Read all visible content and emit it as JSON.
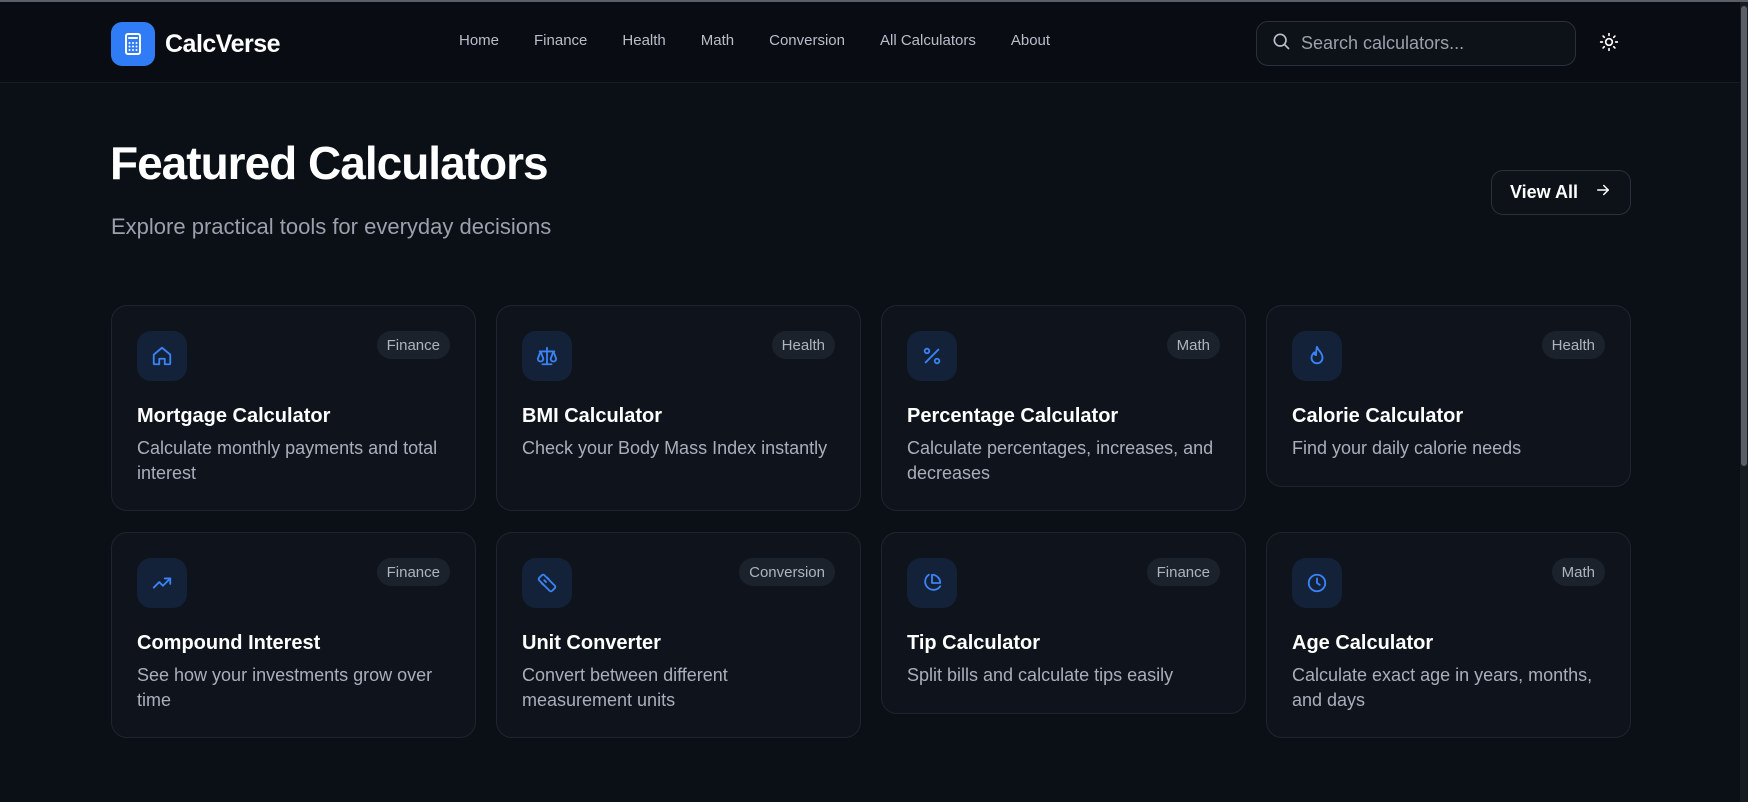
{
  "brand": {
    "name": "CalcVerse",
    "icon": "calculator-icon",
    "accent": "#2f7cf6"
  },
  "nav": {
    "items": [
      {
        "label": "Home"
      },
      {
        "label": "Finance"
      },
      {
        "label": "Health"
      },
      {
        "label": "Math"
      },
      {
        "label": "Conversion"
      },
      {
        "label": "All Calculators"
      },
      {
        "label": "About"
      }
    ]
  },
  "search": {
    "placeholder": "Search calculators...",
    "value": "",
    "icon": "search-icon"
  },
  "theme_toggle": {
    "icon": "sun-icon"
  },
  "hero": {
    "title": "Featured Calculators",
    "subtitle": "Explore practical tools for everyday decisions",
    "view_all_label": "View All",
    "view_all_icon": "arrow-right-icon"
  },
  "cards": [
    {
      "icon": "home-icon",
      "tag": "Finance",
      "title": "Mortgage Calculator",
      "description": "Calculate monthly payments and total interest"
    },
    {
      "icon": "scale-icon",
      "tag": "Health",
      "title": "BMI Calculator",
      "description": "Check your Body Mass Index instantly"
    },
    {
      "icon": "percent-icon",
      "tag": "Math",
      "title": "Percentage Calculator",
      "description": "Calculate percentages, increases, and decreases"
    },
    {
      "icon": "flame-icon",
      "tag": "Health",
      "title": "Calorie Calculator",
      "description": "Find your daily calorie needs"
    },
    {
      "icon": "trending-up-icon",
      "tag": "Finance",
      "title": "Compound Interest",
      "description": "See how your investments grow over time"
    },
    {
      "icon": "ruler-icon",
      "tag": "Conversion",
      "title": "Unit Converter",
      "description": "Convert between different measurement units"
    },
    {
      "icon": "pie-chart-icon",
      "tag": "Finance",
      "title": "Tip Calculator",
      "description": "Split bills and calculate tips easily"
    },
    {
      "icon": "clock-icon",
      "tag": "Math",
      "title": "Age Calculator",
      "description": "Calculate exact age in years, months, and days"
    }
  ]
}
